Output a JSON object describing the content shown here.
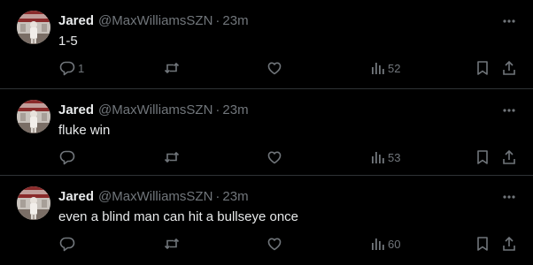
{
  "colors": {
    "background": "#000000",
    "divider": "#2f3336",
    "primary_text": "#e7e9ea",
    "secondary_text": "#71767b"
  },
  "tweets": [
    {
      "author_name": "Jared",
      "handle": "@MaxWilliamsSZN",
      "separator": "·",
      "time": "23m",
      "text": "1-5",
      "reply_count": "1",
      "views": "52"
    },
    {
      "author_name": "Jared",
      "handle": "@MaxWilliamsSZN",
      "separator": "·",
      "time": "23m",
      "text": "fluke win",
      "reply_count": "",
      "views": "53"
    },
    {
      "author_name": "Jared",
      "handle": "@MaxWilliamsSZN",
      "separator": "·",
      "time": "23m",
      "text": "even a blind man can hit a bullseye once",
      "reply_count": "",
      "views": "60"
    }
  ],
  "icons": {
    "more": "more-horizontal-icon",
    "reply": "reply-icon",
    "retweet": "retweet-icon",
    "like": "heart-icon",
    "views": "views-chart-icon",
    "bookmark": "bookmark-icon",
    "share": "share-icon"
  }
}
